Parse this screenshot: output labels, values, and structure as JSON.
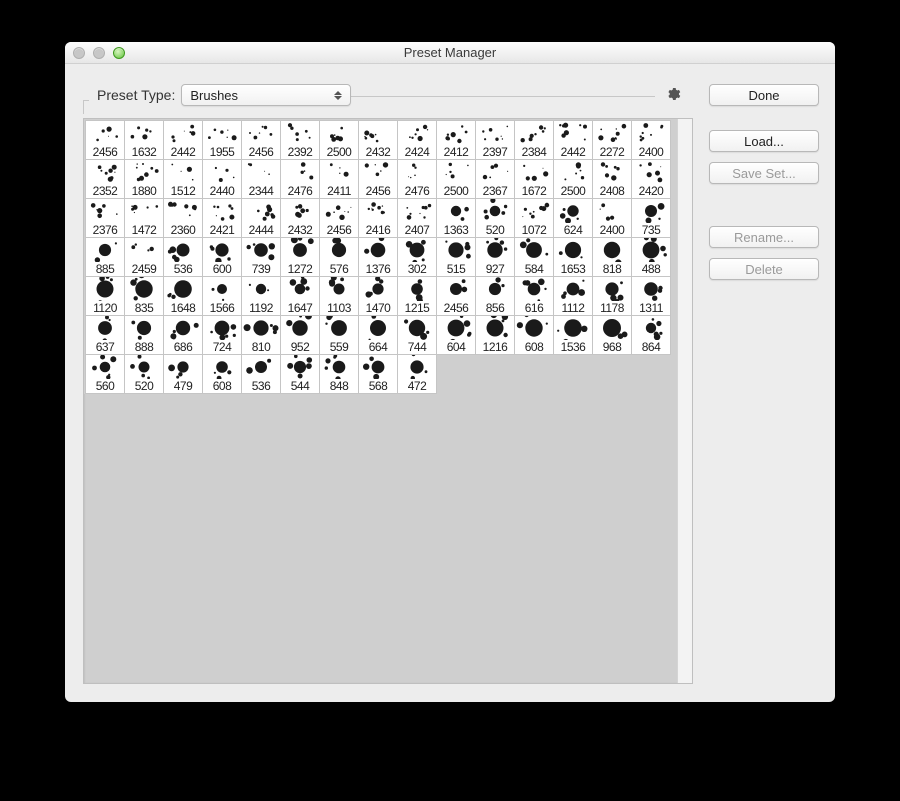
{
  "window": {
    "title": "Preset Manager"
  },
  "header": {
    "preset_type_label": "Preset Type:",
    "preset_type_value": "Brushes"
  },
  "buttons": {
    "done": "Done",
    "load": "Load...",
    "save_set": "Save Set...",
    "rename": "Rename...",
    "delete": "Delete"
  },
  "brushes": [
    {
      "size": 2456,
      "style": "scatter"
    },
    {
      "size": 1632,
      "style": "scatter"
    },
    {
      "size": 2442,
      "style": "scatter"
    },
    {
      "size": 1955,
      "style": "scatter"
    },
    {
      "size": 2456,
      "style": "scatter"
    },
    {
      "size": 2392,
      "style": "scatter"
    },
    {
      "size": 2500,
      "style": "scatter"
    },
    {
      "size": 2432,
      "style": "scatter"
    },
    {
      "size": 2424,
      "style": "scatter"
    },
    {
      "size": 2412,
      "style": "scatter"
    },
    {
      "size": 2397,
      "style": "scatter"
    },
    {
      "size": 2384,
      "style": "scatter"
    },
    {
      "size": 2442,
      "style": "scatter"
    },
    {
      "size": 2272,
      "style": "scatter"
    },
    {
      "size": 2400,
      "style": "scatter"
    },
    {
      "size": 2352,
      "style": "scatter"
    },
    {
      "size": 1880,
      "style": "scatter"
    },
    {
      "size": 1512,
      "style": "scatter"
    },
    {
      "size": 2440,
      "style": "scatter"
    },
    {
      "size": 2344,
      "style": "scatter"
    },
    {
      "size": 2476,
      "style": "scatter"
    },
    {
      "size": 2411,
      "style": "scatter"
    },
    {
      "size": 2456,
      "style": "scatter"
    },
    {
      "size": 2476,
      "style": "scatter"
    },
    {
      "size": 2500,
      "style": "scatter"
    },
    {
      "size": 2367,
      "style": "scatter"
    },
    {
      "size": 1672,
      "style": "scatter"
    },
    {
      "size": 2500,
      "style": "scatter"
    },
    {
      "size": 2408,
      "style": "scatter"
    },
    {
      "size": 2420,
      "style": "scatter"
    },
    {
      "size": 2376,
      "style": "scatter"
    },
    {
      "size": 1472,
      "style": "scatter"
    },
    {
      "size": 2360,
      "style": "scatter"
    },
    {
      "size": 2421,
      "style": "scatter"
    },
    {
      "size": 2444,
      "style": "scatter"
    },
    {
      "size": 2432,
      "style": "scatter"
    },
    {
      "size": 2456,
      "style": "scatter"
    },
    {
      "size": 2416,
      "style": "scatter"
    },
    {
      "size": 2407,
      "style": "scatter"
    },
    {
      "size": 1363,
      "style": "splat"
    },
    {
      "size": 520,
      "style": "splat"
    },
    {
      "size": 1072,
      "style": "scatter"
    },
    {
      "size": 624,
      "style": "splat"
    },
    {
      "size": 2400,
      "style": "scatter"
    },
    {
      "size": 735,
      "style": "splat"
    },
    {
      "size": 885,
      "style": "splat"
    },
    {
      "size": 2459,
      "style": "scatter"
    },
    {
      "size": 536,
      "style": "splat"
    },
    {
      "size": 600,
      "style": "splat"
    },
    {
      "size": 739,
      "style": "splat"
    },
    {
      "size": 1272,
      "style": "splat"
    },
    {
      "size": 576,
      "style": "splat"
    },
    {
      "size": 1376,
      "style": "splat"
    },
    {
      "size": 302,
      "style": "splat"
    },
    {
      "size": 515,
      "style": "splat"
    },
    {
      "size": 927,
      "style": "splat"
    },
    {
      "size": 584,
      "style": "splat"
    },
    {
      "size": 1653,
      "style": "splat"
    },
    {
      "size": 818,
      "style": "splat"
    },
    {
      "size": 488,
      "style": "splat"
    },
    {
      "size": 1120,
      "style": "splat"
    },
    {
      "size": 835,
      "style": "splat"
    },
    {
      "size": 1648,
      "style": "splat"
    },
    {
      "size": 1566,
      "style": "splat"
    },
    {
      "size": 1192,
      "style": "splat"
    },
    {
      "size": 1647,
      "style": "splat"
    },
    {
      "size": 1103,
      "style": "splat"
    },
    {
      "size": 1470,
      "style": "splat"
    },
    {
      "size": 1215,
      "style": "splat"
    },
    {
      "size": 2456,
      "style": "splat"
    },
    {
      "size": 856,
      "style": "splat"
    },
    {
      "size": 616,
      "style": "splat"
    },
    {
      "size": 1112,
      "style": "splat"
    },
    {
      "size": 1178,
      "style": "splat"
    },
    {
      "size": 1311,
      "style": "splat"
    },
    {
      "size": 637,
      "style": "splat"
    },
    {
      "size": 888,
      "style": "splat"
    },
    {
      "size": 686,
      "style": "splat"
    },
    {
      "size": 724,
      "style": "splat"
    },
    {
      "size": 810,
      "style": "splat"
    },
    {
      "size": 952,
      "style": "splat"
    },
    {
      "size": 559,
      "style": "splat"
    },
    {
      "size": 664,
      "style": "splat"
    },
    {
      "size": 744,
      "style": "splat"
    },
    {
      "size": 604,
      "style": "splat"
    },
    {
      "size": 1216,
      "style": "splat"
    },
    {
      "size": 608,
      "style": "splat"
    },
    {
      "size": 1536,
      "style": "splat"
    },
    {
      "size": 968,
      "style": "splat"
    },
    {
      "size": 864,
      "style": "splat"
    },
    {
      "size": 560,
      "style": "splat"
    },
    {
      "size": 520,
      "style": "splat"
    },
    {
      "size": 479,
      "style": "splat"
    },
    {
      "size": 608,
      "style": "splat"
    },
    {
      "size": 536,
      "style": "splat"
    },
    {
      "size": 544,
      "style": "splat"
    },
    {
      "size": 848,
      "style": "splat"
    },
    {
      "size": 568,
      "style": "splat"
    },
    {
      "size": 472,
      "style": "splat"
    }
  ]
}
